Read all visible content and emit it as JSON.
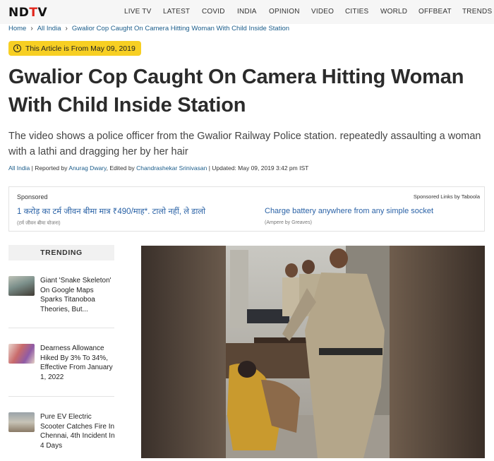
{
  "header": {
    "logo": {
      "left": "ND",
      "accent": "T",
      "right": "V"
    },
    "nav": [
      "LIVE TV",
      "LATEST",
      "COVID",
      "INDIA",
      "OPINION",
      "VIDEO",
      "CITIES",
      "WORLD",
      "OFFBEAT",
      "TRENDS"
    ]
  },
  "breadcrumb": [
    "Home",
    "All India",
    "Gwalior Cop Caught On Camera Hitting Woman With Child Inside Station"
  ],
  "badge": {
    "text": "This Article is From May 09, 2019",
    "icon": "clock-icon",
    "color": "#f7cf23"
  },
  "article": {
    "headline_line1": "Gwalior Cop Caught On Camera Hitting Woman",
    "headline_line2": "With Child Inside Station",
    "summary": "The video shows a police officer from the Gwalior Railway Police station. repeatedly assaulting a woman with a lathi and dragging her by her hair",
    "byline": {
      "section": "All India",
      "reported_prefix": "| Reported by ",
      "reporter": "Anurag Dwary",
      "edited_prefix": ", Edited by ",
      "editor": "Chandrashekar Srinivasan",
      "updated": "| Updated: May 09, 2019 3:42 pm IST"
    }
  },
  "sponsored": {
    "label": "Sponsored",
    "provider": "Sponsored Links by Taboola",
    "ads": [
      {
        "title": "1 करोड़ का टर्म जीवन बीमा मात्र ₹490/माह*. टालो नहीं, ले डालो",
        "source": "(टर्म जीवन बीमा योजना)"
      },
      {
        "title": "Charge battery anywhere from any simple socket",
        "source": "(Ampere by Greaves)"
      }
    ]
  },
  "trending": {
    "heading": "TRENDING",
    "items": [
      {
        "title": "Giant 'Snake Skeleton' On Google Maps Sparks Titanoboa Theories, But..."
      },
      {
        "title": "Dearness Allowance Hiked By 3% To 34%, Effective From January 1, 2022"
      },
      {
        "title": "Pure EV Electric Scooter Catches Fire In Chennai, 4th Incident In 4 Days"
      }
    ]
  },
  "colors": {
    "brand_red": "#e1251b",
    "link_blue": "#1a5c8a",
    "badge_yellow": "#f7cf23"
  }
}
